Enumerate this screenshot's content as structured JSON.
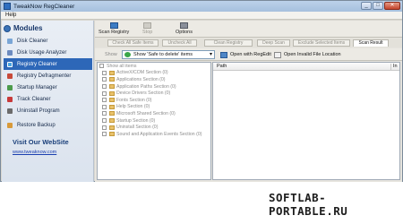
{
  "window": {
    "title": "TweakNow RegCleaner",
    "controls": [
      "_",
      "□",
      "✕"
    ]
  },
  "menu": {
    "help": "Help"
  },
  "sidebar": {
    "header": "Modules",
    "items": [
      {
        "label": "Disk Cleaner",
        "icon": "disk-cleaner-icon",
        "color": "#7aa6d6",
        "active": false
      },
      {
        "label": "Disk Usage Analyzer",
        "icon": "disk-usage-icon",
        "color": "#6c8bbf",
        "active": false
      },
      {
        "label": "Registry Cleaner",
        "icon": "registry-cleaner-icon",
        "color": "#4aa3e0",
        "active": true
      },
      {
        "label": "Registry Defragmenter",
        "icon": "registry-defrag-icon",
        "color": "#c84a3a",
        "active": false
      },
      {
        "label": "Startup Manager",
        "icon": "startup-manager-icon",
        "color": "#4c9b4c",
        "active": false
      },
      {
        "label": "Track Cleaner",
        "icon": "track-cleaner-icon",
        "color": "#c83a3a",
        "active": false
      },
      {
        "label": "Uninstall Program",
        "icon": "uninstall-icon",
        "color": "#6b6b6b",
        "active": false
      },
      {
        "label": "Restore Backup",
        "icon": "restore-backup-icon",
        "color": "#d89a3a",
        "active": false
      }
    ],
    "visit_title": "Visit Our WebSite",
    "visit_link": "www.tweaknow.com"
  },
  "toolbar": {
    "scan_registry": "Scan Registry",
    "stop": "Stop",
    "options": "Options"
  },
  "actions": {
    "check_all": "Check All Safe Items",
    "uncheck_all": "Uncheck All",
    "clean_registry": "Clean Registry",
    "deep_scan": "Deep Scan",
    "exclude_selected": "Exclude Selected Items",
    "scan_result": "Scan Result"
  },
  "filter": {
    "show_label": "Show",
    "show_value": "Show 'Safe to delete' items",
    "open_regedit": "Open with RegEdit",
    "open_invalid_file": "Open Invalid File Location"
  },
  "tree": {
    "root": "Show all items",
    "items": [
      "ActiveX/COM Section (0)",
      "Applications Section (0)",
      "Application Paths Section (0)",
      "Device Drivers Section (0)",
      "Fonts Section (0)",
      "Help Section (0)",
      "Microsoft Shared Section (0)",
      "Startup Section (0)",
      "Uninstall Section (0)",
      "Sound and Application Events Section (0)"
    ]
  },
  "results": {
    "col_path": "Path",
    "col_second": "In"
  },
  "watermark": "SOFTLAB-PORTABLE.RU"
}
